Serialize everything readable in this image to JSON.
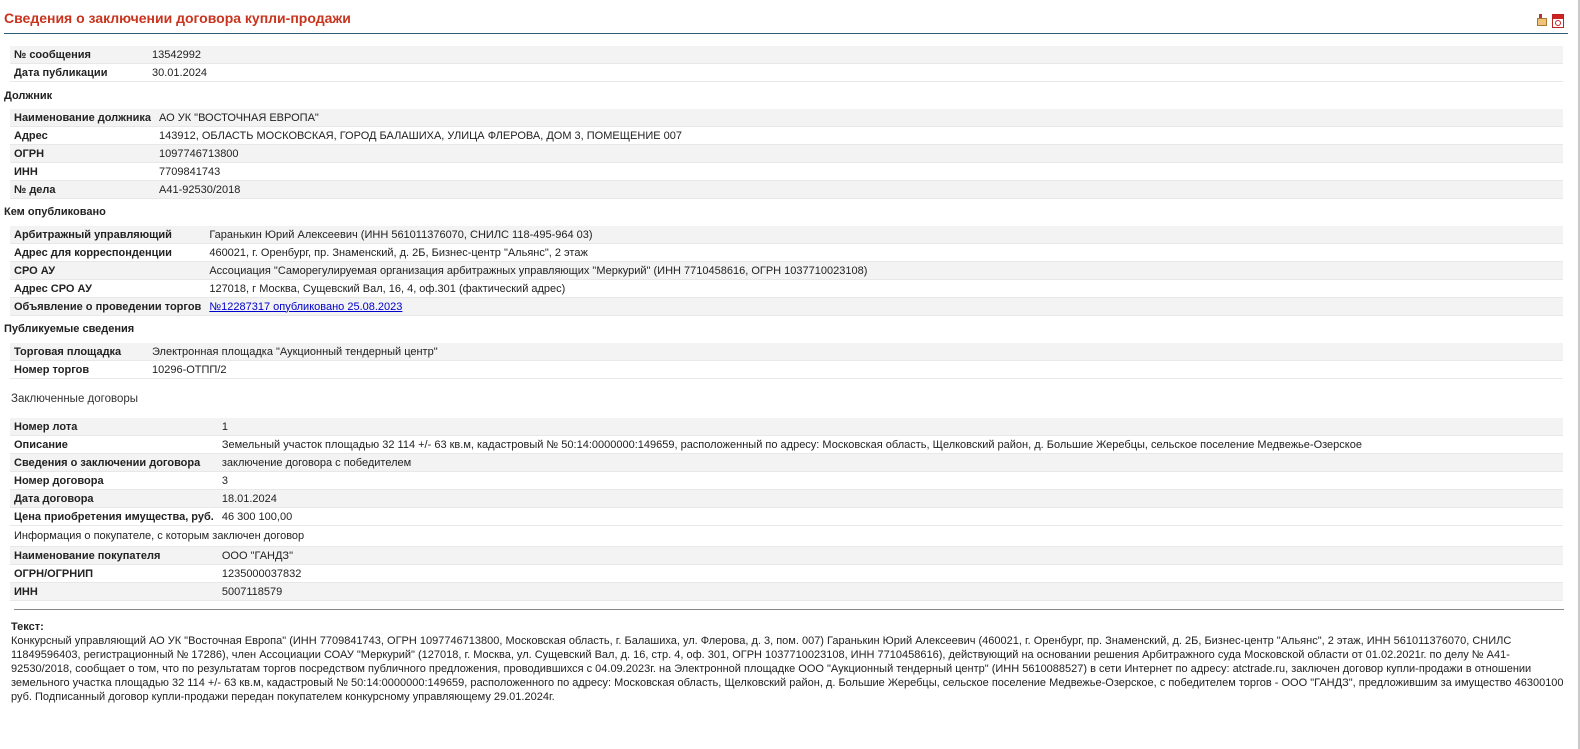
{
  "title": "Сведения о заключении договора купли-продажи",
  "message_table": [
    {
      "label": "№ сообщения",
      "value": "13542992"
    },
    {
      "label": "Дата публикации",
      "value": "30.01.2024"
    }
  ],
  "debtor": {
    "heading": "Должник",
    "rows": [
      {
        "label": "Наименование должника",
        "value": "АО УК \"ВОСТОЧНАЯ ЕВРОПА\""
      },
      {
        "label": "Адрес",
        "value": "143912, ОБЛАСТЬ МОСКОВСКАЯ, ГОРОД БАЛАШИХА, УЛИЦА ФЛЕРОВА, ДОМ 3, ПОМЕЩЕНИЕ 007"
      },
      {
        "label": "ОГРН",
        "value": "1097746713800"
      },
      {
        "label": "ИНН",
        "value": "7709841743"
      },
      {
        "label": "№ дела",
        "value": "А41-92530/2018"
      }
    ]
  },
  "publisher": {
    "heading": "Кем опубликовано",
    "rows": [
      {
        "label": "Арбитражный управляющий",
        "value": "Гаранькин Юрий Алексеевич (ИНН 561011376070,  СНИЛС 118-495-964 03)"
      },
      {
        "label": "Адрес для корреспонденции",
        "value": "460021, г. Оренбург, пр. Знаменский, д. 2Б, Бизнес-центр \"Альянс\", 2 этаж"
      },
      {
        "label": "СРО АУ",
        "value": "Ассоциация \"Саморегулируемая организация арбитражных управляющих \"Меркурий\" (ИНН 7710458616,  ОГРН 1037710023108)"
      },
      {
        "label": "Адрес СРО АУ",
        "value": "127018, г Москва, Сущевский Вал, 16, 4, оф.301 (фактический адрес)"
      },
      {
        "label": "Объявление о проведении торгов",
        "link": "№12287317 опубликовано 25.08.2023"
      }
    ]
  },
  "published": {
    "heading": "Публикуемые сведения",
    "rows": [
      {
        "label": "Торговая площадка",
        "value": "Электронная площадка \"Аукционный тендерный центр\""
      },
      {
        "label": "Номер торгов",
        "value": "10296-ОТПП/2"
      }
    ]
  },
  "contracts": {
    "heading": "Заключенные договоры",
    "rows": [
      {
        "label": "Номер лота",
        "value": "1"
      },
      {
        "label": "Описание",
        "value": "Земельный участок площадью 32 114 +/- 63 кв.м, кадастровый № 50:14:0000000:149659, расположенный по адресу: Московская область, Щелковский район, д. Большие Жеребцы, сельское поселение Медвежье-Озерское"
      },
      {
        "label": "Сведения о заключении договора",
        "value": "заключение договора с победителем"
      },
      {
        "label": "Номер договора",
        "value": "3"
      },
      {
        "label": "Дата договора",
        "value": "18.01.2024"
      },
      {
        "label": "Цена приобретения имущества, руб.",
        "value": "46 300 100,00"
      }
    ],
    "buyer_heading": "Информация о покупателе, с которым заключен договор",
    "buyer_rows": [
      {
        "label": "Наименование покупателя",
        "value": "ООО \"ГАНДЗ\""
      },
      {
        "label": "ОГРН/ОГРНИП",
        "value": "1235000037832"
      },
      {
        "label": "ИНН",
        "value": "5007118579"
      }
    ]
  },
  "text": {
    "label": "Текст:",
    "body": "Конкурсный управляющий АО УК \"Восточная Европа\" (ИНН 7709841743, ОГРН 1097746713800, Московская область, г. Балашиха, ул. Флерова, д. 3, пом. 007) Гаранькин Юрий Алексеевич (460021, г. Оренбург, пр. Знаменский, д. 2Б, Бизнес-центр \"Альянс\", 2 этаж, ИНН 561011376070, СНИЛС 11849596403, регистрационный № 17286), член Ассоциации СОАУ \"Меркурий\" (127018, г. Москва, ул. Сущевский Вал, д. 16, стр. 4, оф. 301, ОГРН 1037710023108, ИНН 7710458616), действующий на основании решения Арбитражного суда Московской области от 01.02.2021г. по делу № А41-92530/2018, сообщает о том, что по результатам торгов посредством публичного предложения, проводившихся с 04.09.2023г. на Электронной площадке ООО \"Аукционный тендерный центр\" (ИНН 5610088527) в сети Интернет по адресу: atctrade.ru, заключен договор купли-продажи в отношении земельного участка площадью 32 114 +/- 63 кв.м, кадастровый № 50:14:0000000:149659, расположенного по адресу: Московская область, Щелковский район, д. Большие Жеребцы, сельское поселение Медвежье-Озерское, с победителем торгов - ООО \"ГАНДЗ\", предложившим за имущество 46300100 руб. Подписанный договор купли-продажи передан покупателем конкурсному управляющему 29.01.2024г."
  },
  "icons": {
    "print": "print-icon",
    "pdf": "pdf-icon"
  },
  "colors": {
    "title": "#c8341e",
    "link": "#0000cc",
    "header_line": "#2b5f75"
  }
}
